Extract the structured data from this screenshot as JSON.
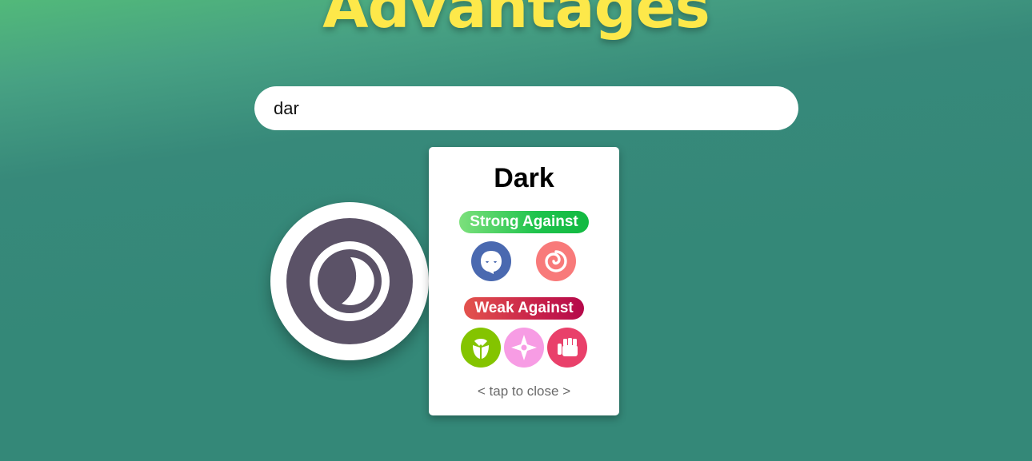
{
  "header": {
    "title": "Advantages"
  },
  "search": {
    "value": "dar"
  },
  "selected_type": {
    "icon": "moon-icon",
    "color": "#5b5267"
  },
  "card": {
    "title": "Dark",
    "strong_label": "Strong Against",
    "strong_types": [
      {
        "icon": "ghost-icon",
        "color": "#4a69b0"
      },
      {
        "icon": "spiral-icon",
        "color": "#f87a7a"
      }
    ],
    "weak_label": "Weak Against",
    "weak_types": [
      {
        "icon": "bug-icon",
        "color": "#84c400"
      },
      {
        "icon": "sparkle-icon",
        "color": "#f79ce4"
      },
      {
        "icon": "fist-icon",
        "color": "#e9406a"
      }
    ],
    "close_hint": "< tap to close >"
  },
  "colors": {
    "title_yellow": "#fde84a",
    "strong_green": "#12b941",
    "weak_red": "#b5094a"
  }
}
